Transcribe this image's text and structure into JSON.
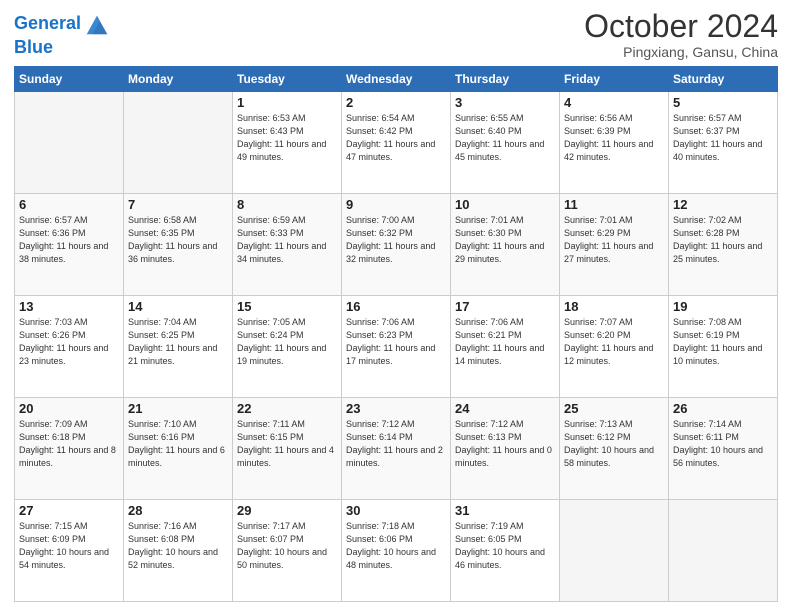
{
  "header": {
    "logo_general": "General",
    "logo_blue": "Blue",
    "month_title": "October 2024",
    "location": "Pingxiang, Gansu, China"
  },
  "weekdays": [
    "Sunday",
    "Monday",
    "Tuesday",
    "Wednesday",
    "Thursday",
    "Friday",
    "Saturday"
  ],
  "weeks": [
    [
      {
        "day": "",
        "sunrise": "",
        "sunset": "",
        "daylight": ""
      },
      {
        "day": "",
        "sunrise": "",
        "sunset": "",
        "daylight": ""
      },
      {
        "day": "1",
        "sunrise": "Sunrise: 6:53 AM",
        "sunset": "Sunset: 6:43 PM",
        "daylight": "Daylight: 11 hours and 49 minutes."
      },
      {
        "day": "2",
        "sunrise": "Sunrise: 6:54 AM",
        "sunset": "Sunset: 6:42 PM",
        "daylight": "Daylight: 11 hours and 47 minutes."
      },
      {
        "day": "3",
        "sunrise": "Sunrise: 6:55 AM",
        "sunset": "Sunset: 6:40 PM",
        "daylight": "Daylight: 11 hours and 45 minutes."
      },
      {
        "day": "4",
        "sunrise": "Sunrise: 6:56 AM",
        "sunset": "Sunset: 6:39 PM",
        "daylight": "Daylight: 11 hours and 42 minutes."
      },
      {
        "day": "5",
        "sunrise": "Sunrise: 6:57 AM",
        "sunset": "Sunset: 6:37 PM",
        "daylight": "Daylight: 11 hours and 40 minutes."
      }
    ],
    [
      {
        "day": "6",
        "sunrise": "Sunrise: 6:57 AM",
        "sunset": "Sunset: 6:36 PM",
        "daylight": "Daylight: 11 hours and 38 minutes."
      },
      {
        "day": "7",
        "sunrise": "Sunrise: 6:58 AM",
        "sunset": "Sunset: 6:35 PM",
        "daylight": "Daylight: 11 hours and 36 minutes."
      },
      {
        "day": "8",
        "sunrise": "Sunrise: 6:59 AM",
        "sunset": "Sunset: 6:33 PM",
        "daylight": "Daylight: 11 hours and 34 minutes."
      },
      {
        "day": "9",
        "sunrise": "Sunrise: 7:00 AM",
        "sunset": "Sunset: 6:32 PM",
        "daylight": "Daylight: 11 hours and 32 minutes."
      },
      {
        "day": "10",
        "sunrise": "Sunrise: 7:01 AM",
        "sunset": "Sunset: 6:30 PM",
        "daylight": "Daylight: 11 hours and 29 minutes."
      },
      {
        "day": "11",
        "sunrise": "Sunrise: 7:01 AM",
        "sunset": "Sunset: 6:29 PM",
        "daylight": "Daylight: 11 hours and 27 minutes."
      },
      {
        "day": "12",
        "sunrise": "Sunrise: 7:02 AM",
        "sunset": "Sunset: 6:28 PM",
        "daylight": "Daylight: 11 hours and 25 minutes."
      }
    ],
    [
      {
        "day": "13",
        "sunrise": "Sunrise: 7:03 AM",
        "sunset": "Sunset: 6:26 PM",
        "daylight": "Daylight: 11 hours and 23 minutes."
      },
      {
        "day": "14",
        "sunrise": "Sunrise: 7:04 AM",
        "sunset": "Sunset: 6:25 PM",
        "daylight": "Daylight: 11 hours and 21 minutes."
      },
      {
        "day": "15",
        "sunrise": "Sunrise: 7:05 AM",
        "sunset": "Sunset: 6:24 PM",
        "daylight": "Daylight: 11 hours and 19 minutes."
      },
      {
        "day": "16",
        "sunrise": "Sunrise: 7:06 AM",
        "sunset": "Sunset: 6:23 PM",
        "daylight": "Daylight: 11 hours and 17 minutes."
      },
      {
        "day": "17",
        "sunrise": "Sunrise: 7:06 AM",
        "sunset": "Sunset: 6:21 PM",
        "daylight": "Daylight: 11 hours and 14 minutes."
      },
      {
        "day": "18",
        "sunrise": "Sunrise: 7:07 AM",
        "sunset": "Sunset: 6:20 PM",
        "daylight": "Daylight: 11 hours and 12 minutes."
      },
      {
        "day": "19",
        "sunrise": "Sunrise: 7:08 AM",
        "sunset": "Sunset: 6:19 PM",
        "daylight": "Daylight: 11 hours and 10 minutes."
      }
    ],
    [
      {
        "day": "20",
        "sunrise": "Sunrise: 7:09 AM",
        "sunset": "Sunset: 6:18 PM",
        "daylight": "Daylight: 11 hours and 8 minutes."
      },
      {
        "day": "21",
        "sunrise": "Sunrise: 7:10 AM",
        "sunset": "Sunset: 6:16 PM",
        "daylight": "Daylight: 11 hours and 6 minutes."
      },
      {
        "day": "22",
        "sunrise": "Sunrise: 7:11 AM",
        "sunset": "Sunset: 6:15 PM",
        "daylight": "Daylight: 11 hours and 4 minutes."
      },
      {
        "day": "23",
        "sunrise": "Sunrise: 7:12 AM",
        "sunset": "Sunset: 6:14 PM",
        "daylight": "Daylight: 11 hours and 2 minutes."
      },
      {
        "day": "24",
        "sunrise": "Sunrise: 7:12 AM",
        "sunset": "Sunset: 6:13 PM",
        "daylight": "Daylight: 11 hours and 0 minutes."
      },
      {
        "day": "25",
        "sunrise": "Sunrise: 7:13 AM",
        "sunset": "Sunset: 6:12 PM",
        "daylight": "Daylight: 10 hours and 58 minutes."
      },
      {
        "day": "26",
        "sunrise": "Sunrise: 7:14 AM",
        "sunset": "Sunset: 6:11 PM",
        "daylight": "Daylight: 10 hours and 56 minutes."
      }
    ],
    [
      {
        "day": "27",
        "sunrise": "Sunrise: 7:15 AM",
        "sunset": "Sunset: 6:09 PM",
        "daylight": "Daylight: 10 hours and 54 minutes."
      },
      {
        "day": "28",
        "sunrise": "Sunrise: 7:16 AM",
        "sunset": "Sunset: 6:08 PM",
        "daylight": "Daylight: 10 hours and 52 minutes."
      },
      {
        "day": "29",
        "sunrise": "Sunrise: 7:17 AM",
        "sunset": "Sunset: 6:07 PM",
        "daylight": "Daylight: 10 hours and 50 minutes."
      },
      {
        "day": "30",
        "sunrise": "Sunrise: 7:18 AM",
        "sunset": "Sunset: 6:06 PM",
        "daylight": "Daylight: 10 hours and 48 minutes."
      },
      {
        "day": "31",
        "sunrise": "Sunrise: 7:19 AM",
        "sunset": "Sunset: 6:05 PM",
        "daylight": "Daylight: 10 hours and 46 minutes."
      },
      {
        "day": "",
        "sunrise": "",
        "sunset": "",
        "daylight": ""
      },
      {
        "day": "",
        "sunrise": "",
        "sunset": "",
        "daylight": ""
      }
    ]
  ]
}
